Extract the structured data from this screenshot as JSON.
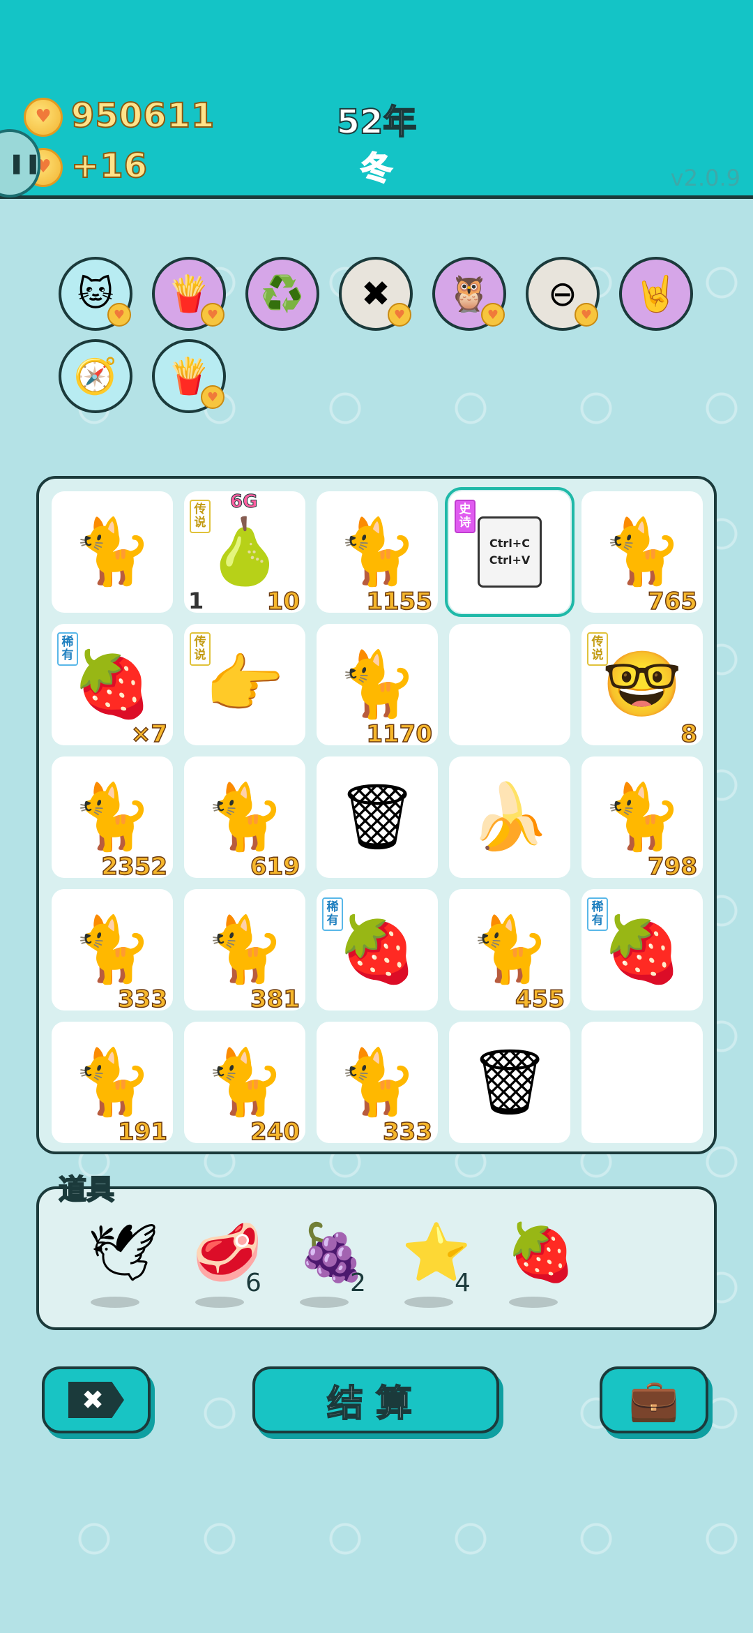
{
  "header": {
    "coins": "950611",
    "income": "+16",
    "year": "52年",
    "season": "冬",
    "version": "v2.0.9"
  },
  "pills": [
    {
      "name": "cat-pill",
      "icon": "🐱",
      "bg": "#b8ecf2",
      "badge": true
    },
    {
      "name": "fries-pill",
      "icon": "🍟",
      "bg": "#d6a6e8",
      "badge": true
    },
    {
      "name": "recycle-pill",
      "icon": "♻️",
      "bg": "#d6a6e8",
      "badge": false
    },
    {
      "name": "remove-pill",
      "icon": "✖",
      "bg": "#e8e4dc",
      "badge": true
    },
    {
      "name": "owl-pill",
      "icon": "🦉",
      "bg": "#d6a6e8",
      "badge": true
    },
    {
      "name": "minus-pill",
      "icon": "⊖",
      "bg": "#e8e4dc",
      "badge": true
    },
    {
      "name": "rock-hand-pill",
      "icon": "🤘",
      "bg": "#d6a6e8",
      "badge": false
    },
    {
      "name": "compass-pill",
      "icon": "🧭",
      "bg": "#b8ecf2",
      "badge": false
    },
    {
      "name": "fries-pill-2",
      "icon": "🍟",
      "bg": "#b8ecf2",
      "badge": true
    }
  ],
  "board": [
    {
      "icon": "🐈",
      "name": "cat",
      "num": ""
    },
    {
      "icon": "🍐",
      "name": "pear-6g",
      "num": "10",
      "lnum": "1",
      "tag": "传说",
      "tagType": "legend",
      "top": "6G"
    },
    {
      "icon": "🐈",
      "name": "cat",
      "num": "1155"
    },
    {
      "icon": "📋",
      "name": "ctrl-c-v",
      "num": "",
      "tag": "史诗",
      "tagType": "epic",
      "selected": true,
      "card": "Ctrl+C\nCtrl+V"
    },
    {
      "icon": "🐈",
      "name": "cat",
      "num": "765"
    },
    {
      "icon": "🍓",
      "name": "lychee",
      "num": "×7",
      "tag": "稀有",
      "tagType": "rare"
    },
    {
      "icon": "👉",
      "name": "pointing-hand",
      "num": "",
      "tag": "传说",
      "tagType": "legend"
    },
    {
      "icon": "🐈",
      "name": "cat",
      "num": "1170"
    },
    {
      "icon": "",
      "name": "empty",
      "num": ""
    },
    {
      "icon": "🤓",
      "name": "king-face",
      "num": "8",
      "tag": "传说",
      "tagType": "legend"
    },
    {
      "icon": "🐈",
      "name": "cat",
      "num": "2352"
    },
    {
      "icon": "🐈",
      "name": "cat",
      "num": "619"
    },
    {
      "icon": "🗑",
      "name": "trash-bag",
      "num": ""
    },
    {
      "icon": "🍌",
      "name": "banana",
      "num": ""
    },
    {
      "icon": "🐈",
      "name": "cat",
      "num": "798"
    },
    {
      "icon": "🐈",
      "name": "cat",
      "num": "333"
    },
    {
      "icon": "🐈",
      "name": "cat",
      "num": "381"
    },
    {
      "icon": "🍓",
      "name": "lychee",
      "num": "",
      "tag": "稀有",
      "tagType": "rare"
    },
    {
      "icon": "🐈",
      "name": "cat",
      "num": "455"
    },
    {
      "icon": "🍓",
      "name": "lychee",
      "num": "",
      "tag": "稀有",
      "tagType": "rare"
    },
    {
      "icon": "🐈",
      "name": "cat",
      "num": "191"
    },
    {
      "icon": "🐈",
      "name": "cat",
      "num": "240"
    },
    {
      "icon": "🐈",
      "name": "cat",
      "num": "333"
    },
    {
      "icon": "🗑",
      "name": "trash-bag",
      "num": ""
    },
    {
      "icon": "",
      "name": "empty",
      "num": ""
    }
  ],
  "props": {
    "label": "道具",
    "items": [
      {
        "icon": "🕊",
        "name": "bird",
        "count": ""
      },
      {
        "icon": "🥩",
        "name": "liver",
        "count": "6"
      },
      {
        "icon": "🍇",
        "name": "bayberry",
        "count": "2"
      },
      {
        "icon": "⭐",
        "name": "star",
        "count": "4"
      },
      {
        "icon": "🍓",
        "name": "strawberry",
        "count": ""
      }
    ]
  },
  "buttons": {
    "settle": "结算",
    "close_icon": "✖",
    "bag_icon": "💼"
  }
}
